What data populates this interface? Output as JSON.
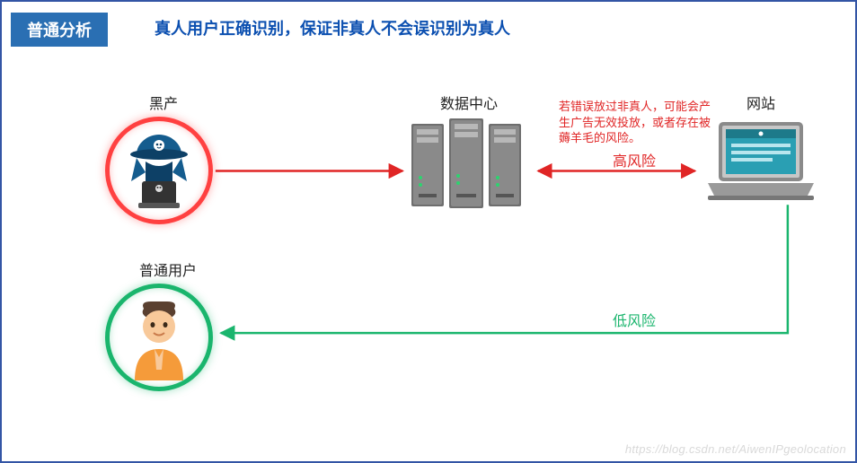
{
  "badge": "普通分析",
  "headline": "真人用户正确识别，保证非真人不会误识别为真人",
  "node": {
    "hacker": "黑产",
    "datacenter": "数据中心",
    "website": "网站",
    "user": "普通用户"
  },
  "warning": "若错误放过非真人，可能会产生广告无效投放，或者存在被薅羊毛的风险。",
  "risk": {
    "high": "高风险",
    "low": "低风险"
  },
  "colors": {
    "red": "#e02525",
    "green": "#1ab56d",
    "blue": "#2a6fb3"
  },
  "watermark": "https://blog.csdn.net/AiwenIPgeolocation"
}
